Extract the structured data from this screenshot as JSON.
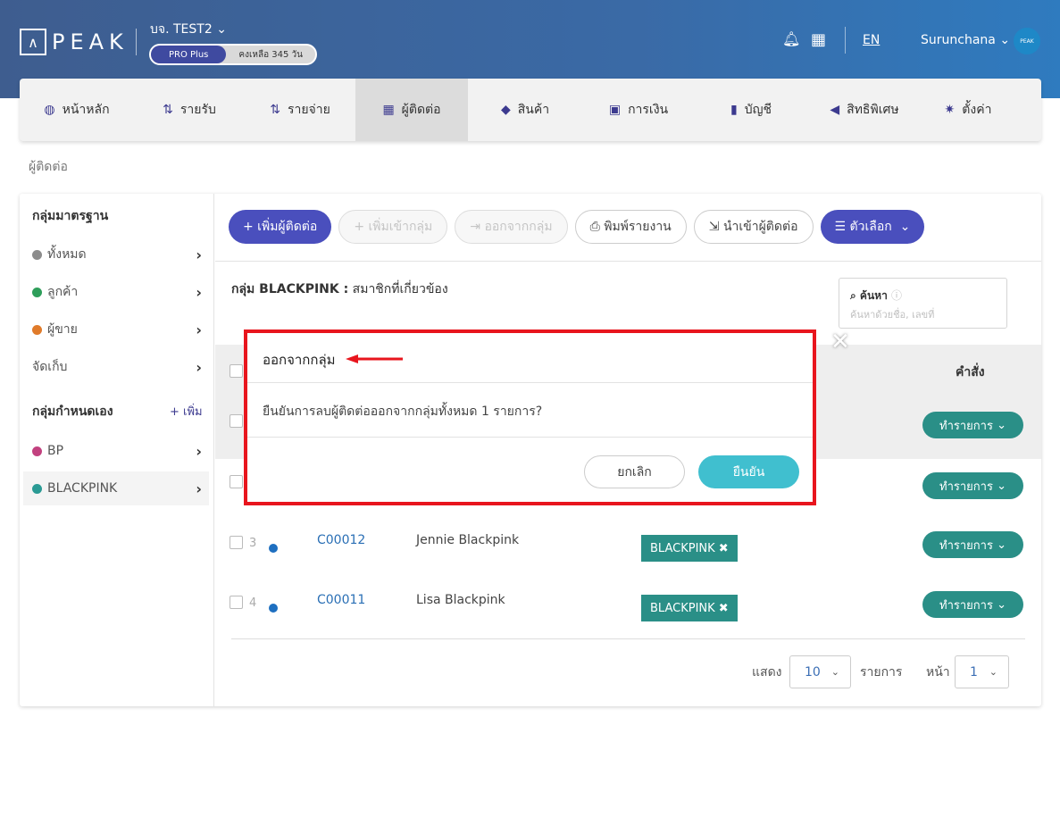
{
  "header": {
    "logo_text": "PEAK",
    "company": "บจ. TEST2",
    "plan": "PRO Plus",
    "days_left": "คงเหลือ 345 วัน",
    "lang": "EN",
    "user": "Surunchana",
    "avatar_text": "PEAK"
  },
  "nav": {
    "items": [
      {
        "label": "หน้าหลัก",
        "icon": "dashboard-icon",
        "glyph": "◍"
      },
      {
        "label": "รายรับ",
        "icon": "income-icon",
        "glyph": "⇅"
      },
      {
        "label": "รายจ่าย",
        "icon": "expense-icon",
        "glyph": "⇅"
      },
      {
        "label": "ผู้ติดต่อ",
        "icon": "contacts-icon",
        "glyph": "▦"
      },
      {
        "label": "สินค้า",
        "icon": "product-icon",
        "glyph": "◆"
      },
      {
        "label": "การเงิน",
        "icon": "money-icon",
        "glyph": "▣"
      },
      {
        "label": "บัญชี",
        "icon": "account-book-icon",
        "glyph": "▮"
      },
      {
        "label": "สิทธิพิเศษ",
        "icon": "megaphone-icon",
        "glyph": "◀"
      },
      {
        "label": "ตั้งค่า",
        "icon": "gear-icon",
        "glyph": "✷"
      }
    ]
  },
  "breadcrumb": "ผู้ติดต่อ",
  "sidebar": {
    "standard_heading": "กลุ่มมาตรฐาน",
    "standard_items": [
      {
        "label": "ทั้งหมด",
        "color": "#8c8c8c"
      },
      {
        "label": "ลูกค้า",
        "color": "#2e9e5a"
      },
      {
        "label": "ผู้ขาย",
        "color": "#e07b2a"
      },
      {
        "label": "จัดเก็บ",
        "color": ""
      }
    ],
    "custom_heading": "กลุ่มกำหนดเอง",
    "add_label": "+ เพิ่ม",
    "custom_items": [
      {
        "label": "BP",
        "color": "#c2417f"
      },
      {
        "label": "BLACKPINK",
        "color": "#2a9a94"
      }
    ]
  },
  "toolbar": {
    "add_contact": "+ เพิ่มผู้ติดต่อ",
    "add_to_group": "+ เพิ่มเข้ากลุ่ม",
    "leave_group": "ออกจากกลุ่ม",
    "print_report": "พิมพ์รายงาน",
    "import_contacts": "นำเข้าผู้ติดต่อ",
    "options": "ตัวเลือก"
  },
  "group_title_bold": "กลุ่ม BLACKPINK :",
  "group_title_rest": "สมาชิกที่เกี่ยวข้อง",
  "search": {
    "label": "ค้นหา",
    "placeholder": "ค้นหาด้วยชื่อ, เลขที่"
  },
  "table": {
    "command_header": "คำสั่ง",
    "action_label": "ทำรายการ",
    "rows": [
      {
        "num": "3",
        "code": "C00012",
        "name": "Jennie Blackpink",
        "tag": "BLACKPINK"
      },
      {
        "num": "4",
        "code": "C00011",
        "name": "Lisa Blackpink",
        "tag": "BLACKPINK"
      }
    ]
  },
  "pagination": {
    "show": "แสดง",
    "per_page": "10",
    "items": "รายการ",
    "page_label": "หน้า",
    "page": "1"
  },
  "modal": {
    "title": "ออกจากกลุ่ม",
    "body": "ยืนยันการลบผู้ติดต่อออกจากกลุ่มทั้งหมด 1 รายการ?",
    "cancel": "ยกเลิก",
    "confirm": "ยืนยัน",
    "close_glyph": "✕"
  },
  "colors": {
    "primary": "#4a4fbd",
    "teal": "#2a8f87",
    "confirm": "#40bfcf",
    "highlight": "#e8151d"
  }
}
